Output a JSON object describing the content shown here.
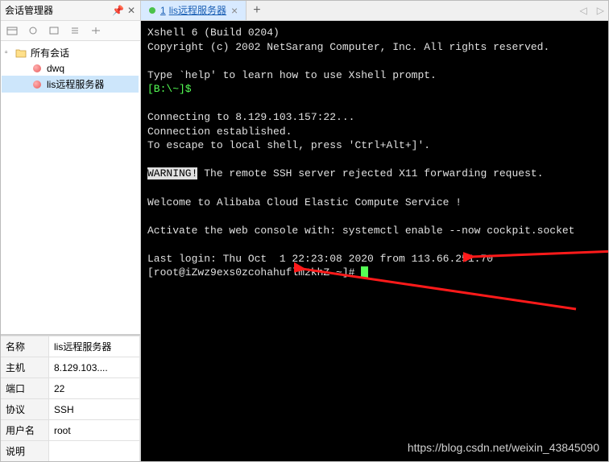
{
  "sidebar": {
    "title": "会话管理器",
    "tree": [
      {
        "label": "所有会话",
        "icon": "folder",
        "indent": 0,
        "expanded": true
      },
      {
        "label": "dwq",
        "icon": "dot-pink",
        "indent": 1
      },
      {
        "label": "lis远程服务器",
        "icon": "dot-pink",
        "indent": 1,
        "selected": true
      }
    ]
  },
  "properties": {
    "rows": [
      {
        "key": "名称",
        "value": "lis远程服务器"
      },
      {
        "key": "主机",
        "value": "8.129.103...."
      },
      {
        "key": "端口",
        "value": "22"
      },
      {
        "key": "协议",
        "value": "SSH"
      },
      {
        "key": "用户名",
        "value": "root"
      },
      {
        "key": "说明",
        "value": ""
      }
    ]
  },
  "tab": {
    "index": "1",
    "label": "lis远程服务器"
  },
  "terminal": {
    "line1": "Xshell 6 (Build 0204)",
    "line2": "Copyright (c) 2002 NetSarang Computer, Inc. All rights reserved.",
    "line3": "Type `help' to learn how to use Xshell prompt.",
    "line4": "[B:\\~]$",
    "line5": "Connecting to 8.129.103.157:22...",
    "line6": "Connection established.",
    "line7": "To escape to local shell, press 'Ctrl+Alt+]'.",
    "line8a": "WARNING!",
    "line8b": " The remote SSH server rejected X11 forwarding request.",
    "line9": "Welcome to Alibaba Cloud Elastic Compute Service !",
    "line10": "Activate the web console with: systemctl enable --now cockpit.socket",
    "line11": "Last login: Thu Oct  1 22:23:08 2020 from 113.66.251.70",
    "line12": "[root@iZwz9exs0zcohahuflm2khZ ~]# "
  },
  "watermark": "https://blog.csdn.net/weixin_43845090"
}
